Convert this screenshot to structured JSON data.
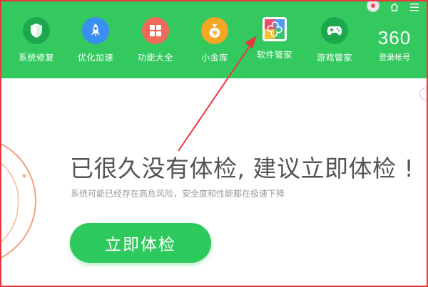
{
  "nav": {
    "items": [
      {
        "label": "系统修复",
        "icon": "shield-icon",
        "color": "#1ea84d"
      },
      {
        "label": "优化加速",
        "icon": "rocket-icon",
        "color": "#3a8ff0"
      },
      {
        "label": "功能大全",
        "icon": "grid-icon",
        "color": "#f06a5a"
      },
      {
        "label": "小金库",
        "icon": "money-bag-icon",
        "color": "#f5a623"
      },
      {
        "label": "软件管家",
        "icon": "software-manager-icon",
        "color": "#ffffff"
      },
      {
        "label": "游戏管家",
        "icon": "gamepad-icon",
        "color": "#1ea84d"
      }
    ]
  },
  "account": {
    "logo": "360",
    "login_label": "登录帐号"
  },
  "main": {
    "headline": "已很久没有体检, 建议立即体检 !",
    "subtext": "系统可能已经存在高危风险，安全度和性能都在极速下降",
    "cta_label": "立即体检"
  },
  "colors": {
    "header_bg": "#33c95f",
    "frame_border": "#e8383d",
    "annotation_arrow": "#e8383d"
  }
}
